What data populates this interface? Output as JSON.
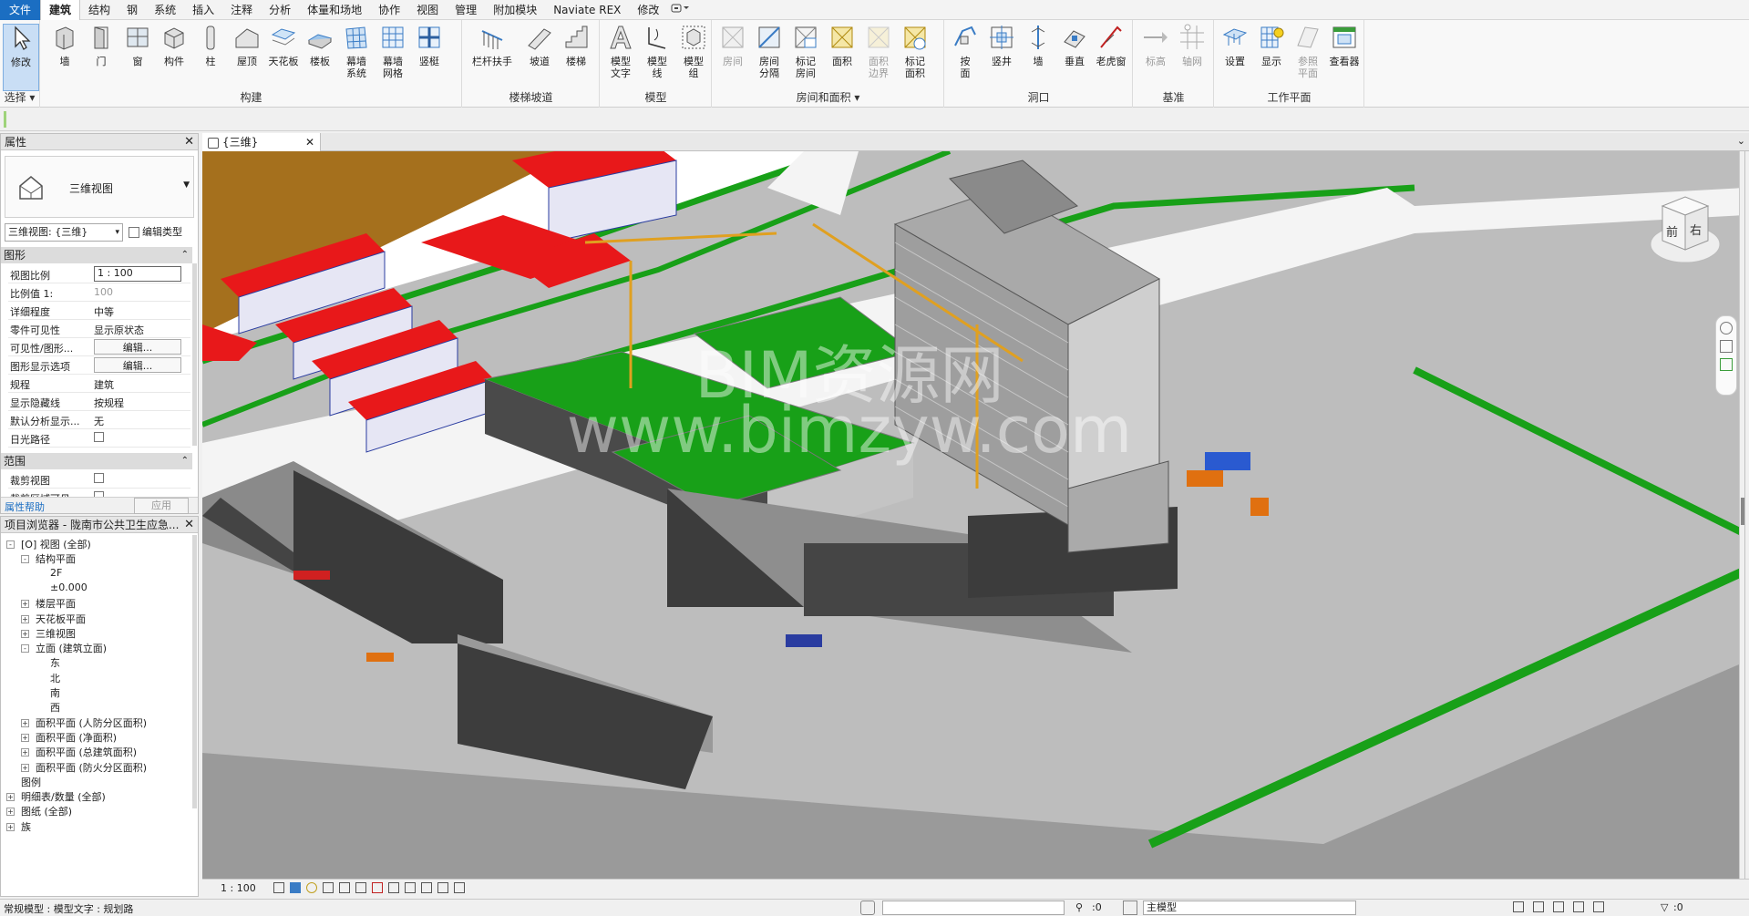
{
  "menu": {
    "items": [
      "文件",
      "建筑",
      "结构",
      "钢",
      "系统",
      "插入",
      "注释",
      "分析",
      "体量和场地",
      "协作",
      "视图",
      "管理",
      "附加模块",
      "Naviate REX",
      "修改"
    ]
  },
  "ribbon": {
    "select": {
      "modify": "修改",
      "group": "选择 ▾"
    },
    "build": {
      "group": "构建",
      "buttons": [
        "墙",
        "门",
        "窗",
        "构件",
        "柱",
        "屋顶",
        "天花板",
        "楼板",
        "幕墙\n系统",
        "幕墙\n网格",
        "竖梃"
      ]
    },
    "stairs": {
      "group": "楼梯坡道",
      "buttons": [
        "栏杆扶手",
        "坡道",
        "楼梯"
      ]
    },
    "model": {
      "group": "模型",
      "buttons": [
        "模型\n文字",
        "模型\n线",
        "模型\n组"
      ]
    },
    "room": {
      "group": "房间和面积 ▾",
      "buttons": [
        "房间",
        "房间\n分隔",
        "标记\n房间",
        "面积",
        "面积\n边界",
        "标记\n面积"
      ]
    },
    "opening": {
      "group": "洞口",
      "buttons": [
        "按\n面",
        "竖井",
        "墙",
        "垂直",
        "老虎窗"
      ]
    },
    "datum": {
      "group": "基准",
      "buttons": [
        "标高",
        "轴网"
      ]
    },
    "workplane": {
      "group": "工作平面",
      "buttons": [
        "设置",
        "显示",
        "参照\n平面",
        "查看器"
      ]
    }
  },
  "properties": {
    "title": "属性",
    "type_name": "三维视图",
    "selector": "三维视图: {三维}",
    "edit_type": "编辑类型",
    "graphics_section": "图形",
    "rows": [
      {
        "k": "视图比例",
        "v": "1 : 100"
      },
      {
        "k": "比例值 1:",
        "v": "100"
      },
      {
        "k": "详细程度",
        "v": "中等"
      },
      {
        "k": "零件可见性",
        "v": "显示原状态"
      },
      {
        "k": "可见性/图形...",
        "v": "编辑..."
      },
      {
        "k": "图形显示选项",
        "v": "编辑..."
      },
      {
        "k": "规程",
        "v": "建筑"
      },
      {
        "k": "显示隐藏线",
        "v": "按规程"
      },
      {
        "k": "默认分析显示...",
        "v": "无"
      },
      {
        "k": "日光路径",
        "v": ""
      }
    ],
    "extent_section": "范围",
    "extent_rows": [
      {
        "k": "裁剪视图",
        "v": ""
      },
      {
        "k": "裁剪区域可见",
        "v": ""
      }
    ],
    "help": "属性帮助",
    "apply": "应用"
  },
  "browser": {
    "title": "项目浏览器 - 陇南市公共卫生应急...",
    "items": [
      {
        "label": "[O] 视图 (全部)",
        "level": 0,
        "toggle": "-"
      },
      {
        "label": "结构平面",
        "level": 1,
        "toggle": "-"
      },
      {
        "label": "2F",
        "level": 2,
        "toggle": ""
      },
      {
        "label": "±0.000",
        "level": 2,
        "toggle": ""
      },
      {
        "label": "楼层平面",
        "level": 1,
        "toggle": "+"
      },
      {
        "label": "天花板平面",
        "level": 1,
        "toggle": "+"
      },
      {
        "label": "三维视图",
        "level": 1,
        "toggle": "+"
      },
      {
        "label": "立面 (建筑立面)",
        "level": 1,
        "toggle": "-"
      },
      {
        "label": "东",
        "level": 2,
        "toggle": ""
      },
      {
        "label": "北",
        "level": 2,
        "toggle": ""
      },
      {
        "label": "南",
        "level": 2,
        "toggle": ""
      },
      {
        "label": "西",
        "level": 2,
        "toggle": ""
      },
      {
        "label": "面积平面 (人防分区面积)",
        "level": 1,
        "toggle": "+"
      },
      {
        "label": "面积平面 (净面积)",
        "level": 1,
        "toggle": "+"
      },
      {
        "label": "面积平面 (总建筑面积)",
        "level": 1,
        "toggle": "+"
      },
      {
        "label": "面积平面 (防火分区面积)",
        "level": 1,
        "toggle": "+"
      },
      {
        "label": "图例",
        "level": 0,
        "toggle": ""
      },
      {
        "label": "明细表/数量 (全部)",
        "level": 0,
        "toggle": "+"
      },
      {
        "label": "图纸 (全部)",
        "level": 0,
        "toggle": "+"
      },
      {
        "label": "族",
        "level": 0,
        "toggle": "+"
      }
    ]
  },
  "view": {
    "tab_label": "{三维}",
    "scale": "1 : 100",
    "viewcube_front": "前",
    "viewcube_right": "右",
    "watermark_top": "BIM资源网",
    "watermark_bottom": "www.bimzyw.com"
  },
  "status": {
    "text": "常规模型 : 模型文字 : 规划路",
    "filter_count": ":0",
    "model": "主模型",
    "selection_count": ":0"
  },
  "colors": {
    "accent": "#1b6ec2",
    "grass": "#18a018",
    "roof_red": "#e8181a",
    "crane": "#e0a020",
    "soil": "#a5701d"
  }
}
